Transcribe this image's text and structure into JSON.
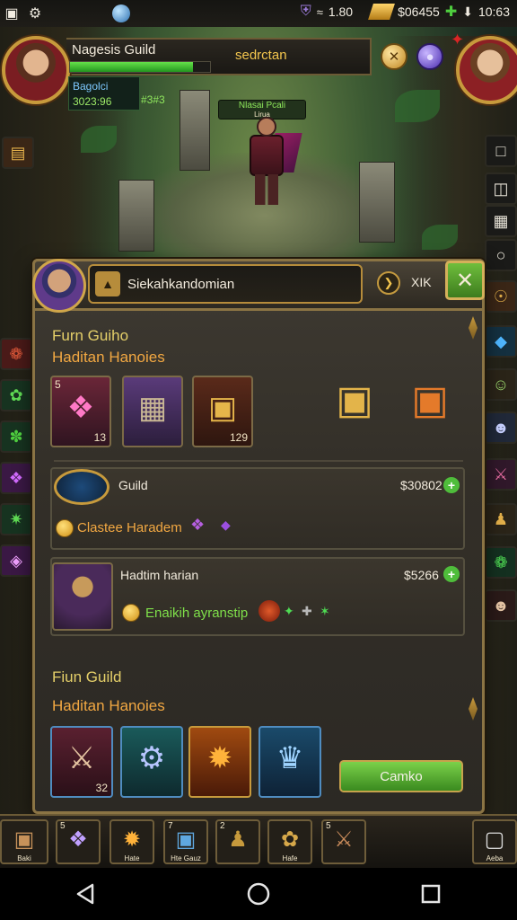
{
  "status_bar": {
    "left_icons": [
      "no-signal-icon",
      "gear-icon",
      "orb-icon"
    ],
    "signal": "1.80",
    "gold": "$06455",
    "time": "10:63"
  },
  "guild_header": {
    "name": "Nagesis Guild",
    "search_text": "sedrctan",
    "sub_label": "Bagolci",
    "sub_value": "3023:96",
    "sub_value2": "#3#3",
    "hp_fraction": 0.88
  },
  "hero": {
    "name": "Nlasai Pcali",
    "title": "Lirua"
  },
  "panel": {
    "search_value": "Siekahkandomian",
    "right_label": "XIK",
    "section1_title": "Furn Guiho",
    "section1_subtitle": "Haditan Hanoies",
    "items": [
      {
        "level": "5",
        "count": "13",
        "glyph": "crystal-icon"
      },
      {
        "level": "",
        "count": "",
        "glyph": "cannon-icon"
      },
      {
        "level": "",
        "count": "129",
        "glyph": "chest-icon"
      }
    ],
    "row1": {
      "title": "Guild",
      "price": "$30802",
      "subtitle": "Clastee Haradem"
    },
    "row2": {
      "title": "Hadtim harian",
      "price": "$5266",
      "subtitle": "Enaikih ayranstip"
    },
    "section2_title": "Fiun Guild",
    "section2_subtitle": "Haditan Hanoies",
    "items2": [
      {
        "level": "",
        "count": "32",
        "glyph": "sword-icon"
      },
      {
        "level": "",
        "count": "",
        "glyph": "gear-icon"
      },
      {
        "level": "",
        "count": "",
        "glyph": "fire-icon"
      },
      {
        "level": "",
        "count": "",
        "glyph": "trophy-icon"
      }
    ],
    "cta_label": "Camko"
  },
  "hotbar": {
    "left_label": "Baki",
    "slots": [
      {
        "num": "5",
        "label": ""
      },
      {
        "num": "",
        "label": "Hate"
      },
      {
        "num": "7",
        "label": "Hte Gauz"
      },
      {
        "num": "2",
        "label": ""
      },
      {
        "num": "",
        "label": "Hafe"
      },
      {
        "num": "5",
        "label": ""
      }
    ],
    "right_label": "Aeba"
  },
  "colors": {
    "accent_gold": "#c79a3c",
    "progress_green": "#65e14a",
    "panel_bg": "#332f28"
  }
}
